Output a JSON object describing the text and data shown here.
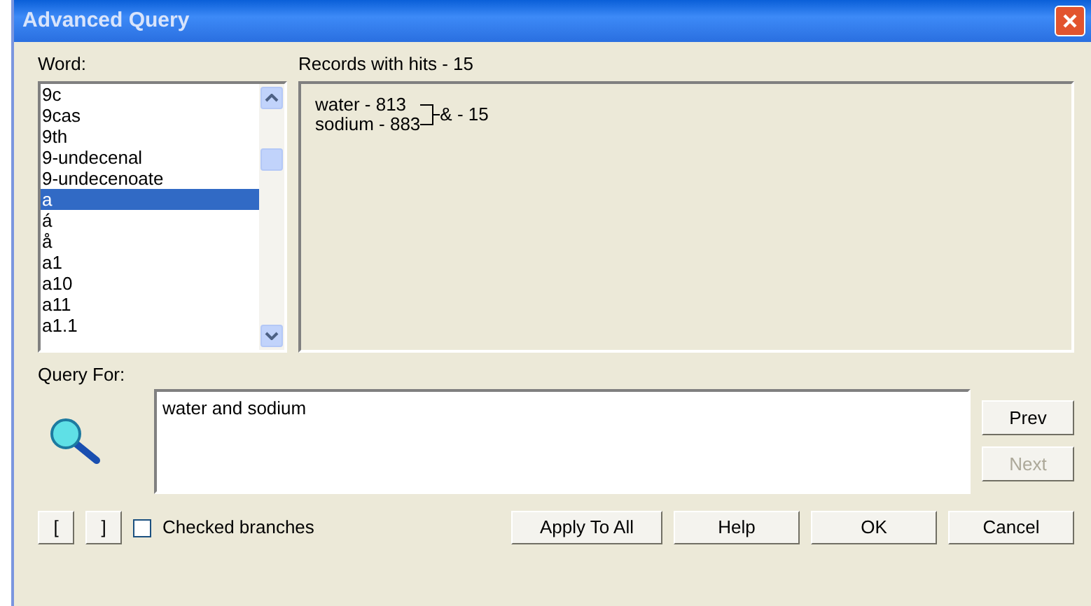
{
  "window": {
    "title": "Advanced Query"
  },
  "word_list": {
    "label": "Word:",
    "items": [
      {
        "text": "9c",
        "selected": false
      },
      {
        "text": "9cas",
        "selected": false
      },
      {
        "text": "9th",
        "selected": false
      },
      {
        "text": "9-undecenal",
        "selected": false
      },
      {
        "text": "9-undecenoate",
        "selected": false
      },
      {
        "text": "a",
        "selected": true
      },
      {
        "text": "á",
        "selected": false
      },
      {
        "text": "å",
        "selected": false
      },
      {
        "text": "a1",
        "selected": false
      },
      {
        "text": "a10",
        "selected": false
      },
      {
        "text": "a11",
        "selected": false
      },
      {
        "text": "a1.1",
        "selected": false
      }
    ]
  },
  "records": {
    "label": "Records with hits - 15",
    "terms": [
      "water - 813",
      "sodium - 883"
    ],
    "combined": "& - 15"
  },
  "query": {
    "label": "Query For:",
    "value": "water and sodium"
  },
  "nav_buttons": [
    {
      "label": "Prev",
      "disabled": false
    },
    {
      "label": "Next",
      "disabled": true
    }
  ],
  "bracket_buttons": [
    "[",
    "]"
  ],
  "checked_branches": {
    "label": "Checked branches",
    "checked": false
  },
  "buttons": [
    "Apply To All",
    "Help",
    "OK",
    "Cancel"
  ]
}
